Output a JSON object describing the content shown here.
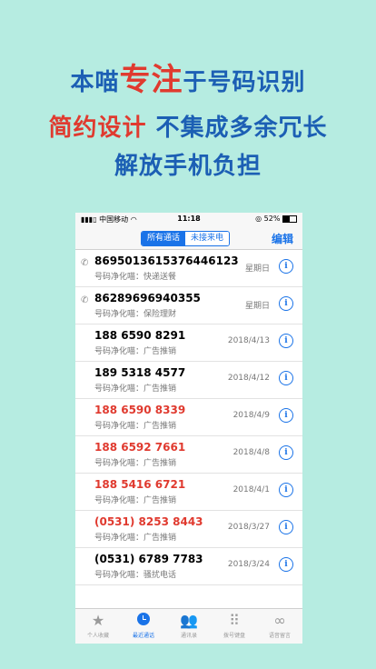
{
  "headlines": {
    "line1_pre": "本喵",
    "line1_accent": "专注",
    "line1_post": "于号码识别",
    "line2_accent": "简约设计",
    "line2_post": "不集成多余冗长",
    "line3": "解放手机负担"
  },
  "status": {
    "carrier": "中国移动",
    "time": "11:18",
    "battery": "52%"
  },
  "nav": {
    "tab_all": "所有通话",
    "tab_missed": "未接来电",
    "edit": "编辑"
  },
  "calls": [
    {
      "number": "8695013615376446123",
      "label": "号码净化喵：快递送餐",
      "date": "星期日",
      "red": false,
      "phone_icon": true
    },
    {
      "number": "86289696940355",
      "label": "号码净化喵：保险理财",
      "date": "星期日",
      "red": false,
      "phone_icon": true
    },
    {
      "number": "188 6590 8291",
      "label": "号码净化喵：广告推销",
      "date": "2018/4/13",
      "red": false,
      "phone_icon": false
    },
    {
      "number": "189 5318 4577",
      "label": "号码净化喵：广告推销",
      "date": "2018/4/12",
      "red": false,
      "phone_icon": false
    },
    {
      "number": "188 6590 8339",
      "label": "号码净化喵：广告推销",
      "date": "2018/4/9",
      "red": true,
      "phone_icon": false
    },
    {
      "number": "188 6592 7661",
      "label": "号码净化喵：广告推销",
      "date": "2018/4/8",
      "red": true,
      "phone_icon": false
    },
    {
      "number": "188 5416 6721",
      "label": "号码净化喵：广告推销",
      "date": "2018/4/1",
      "red": true,
      "phone_icon": false
    },
    {
      "number": "(0531) 8253 8443",
      "label": "号码净化喵：广告推销",
      "date": "2018/3/27",
      "red": true,
      "phone_icon": false
    },
    {
      "number": "(0531) 6789 7783",
      "label": "号码净化喵：骚扰电话",
      "date": "2018/3/24",
      "red": false,
      "phone_icon": false
    }
  ],
  "tabs": [
    {
      "label": "个人收藏",
      "icon": "star-icon"
    },
    {
      "label": "最近通话",
      "icon": "clock-icon"
    },
    {
      "label": "通讯录",
      "icon": "contacts-icon"
    },
    {
      "label": "拨号键盘",
      "icon": "keypad-icon"
    },
    {
      "label": "语音留言",
      "icon": "voicemail-icon"
    }
  ],
  "colors": {
    "background": "#b6ece1",
    "headline": "#1c5fb4",
    "accent": "#e03a2f",
    "ios_blue": "#1a73e8"
  }
}
